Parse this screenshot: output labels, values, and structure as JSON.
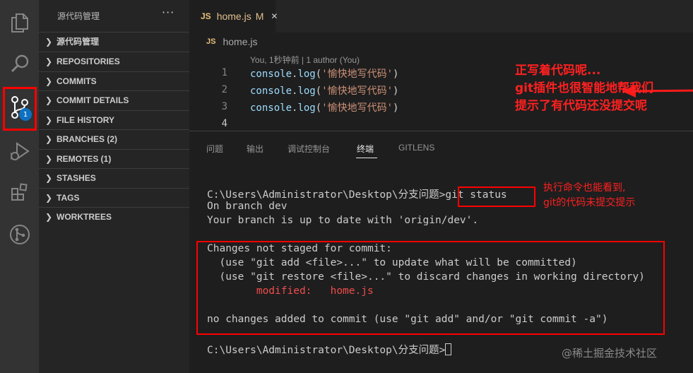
{
  "sidebar": {
    "title": "源代码管理",
    "more_label": "···",
    "sections": [
      {
        "label": "源代码管理"
      },
      {
        "label": "REPOSITORIES"
      },
      {
        "label": "COMMITS"
      },
      {
        "label": "COMMIT DETAILS"
      },
      {
        "label": "FILE HISTORY"
      },
      {
        "label": "BRANCHES (2)"
      },
      {
        "label": "REMOTES (1)"
      },
      {
        "label": "STASHES"
      },
      {
        "label": "TAGS"
      },
      {
        "label": "WORKTREES"
      }
    ]
  },
  "activity_bar": {
    "icons": [
      "explorer-icon",
      "search-icon",
      "source-control-icon",
      "run-debug-icon",
      "extensions-icon",
      "gitlens-icon"
    ],
    "scm_badge": "1",
    "highlight_color": "#ff0000"
  },
  "editor": {
    "tab": {
      "lang": "JS",
      "filename": "home.js",
      "status": "M",
      "close": "✕"
    },
    "breadcrumb": {
      "lang": "JS",
      "filename": "home.js"
    },
    "codelens": "You, 1秒钟前 | 1 author (You)",
    "lines": [
      {
        "num": "1",
        "obj": "console",
        "dot": ".",
        "fn": "log",
        "open": "(",
        "str": "'愉快地写代码'",
        "close": ")"
      },
      {
        "num": "2",
        "obj": "console",
        "dot": ".",
        "fn": "log",
        "open": "(",
        "str": "'愉快地写代码'",
        "close": ")"
      },
      {
        "num": "3",
        "obj": "console",
        "dot": ".",
        "fn": "log",
        "open": "(",
        "str": "'愉快地写代码'",
        "close": ")"
      },
      {
        "num": "4"
      }
    ]
  },
  "annotation_editor": {
    "line1": "正写着代码呢...",
    "line2": "git插件也很智能地帮我们",
    "line3": "提示了有代码还没提交呢"
  },
  "panel": {
    "tabs": [
      {
        "label": "问题"
      },
      {
        "label": "输出"
      },
      {
        "label": "调试控制台"
      },
      {
        "label": "终端",
        "active": true
      },
      {
        "label": "GITLENS"
      }
    ],
    "terminal": {
      "prompt1": "C:\\Users\\Administrator\\Desktop\\分支问题>",
      "command": "git status",
      "out1": "On branch dev",
      "out2": "Your branch is up to date with 'origin/dev'.",
      "out3": "Changes not staged for commit:",
      "out4": "  (use \"git add <file>...\" to update what will be committed)",
      "out5": "  (use \"git restore <file>...\" to discard changes in working directory)",
      "modified": "        modified:   home.js",
      "out6": "no changes added to commit (use \"git add\" and/or \"git commit -a\")",
      "prompt2": "C:\\Users\\Administrator\\Desktop\\分支问题>"
    }
  },
  "annotation_terminal": {
    "line1": "执行命令也能看到,",
    "line2": "git的代码未提交提示"
  },
  "watermark": "@稀土掘金技术社区"
}
